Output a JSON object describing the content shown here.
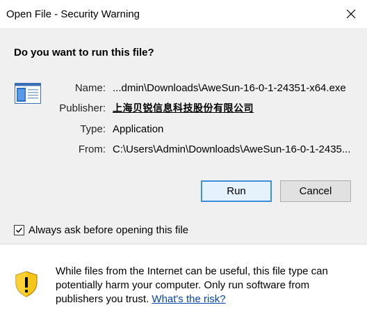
{
  "window": {
    "title": "Open File - Security Warning"
  },
  "dialog": {
    "heading": "Do you want to run this file?",
    "fields": {
      "name_label": "Name:",
      "name_value": "...dmin\\Downloads\\AweSun-16-0-1-24351-x64.exe",
      "publisher_label": "Publisher:",
      "publisher_value": "上海贝锐信息科技股份有限公司",
      "type_label": "Type:",
      "type_value": "Application",
      "from_label": "From:",
      "from_value": "C:\\Users\\Admin\\Downloads\\AweSun-16-0-1-2435..."
    },
    "buttons": {
      "run": "Run",
      "cancel": "Cancel"
    },
    "checkbox": {
      "label": "Always ask before opening this file",
      "checked": true
    }
  },
  "footer": {
    "warning_text": "While files from the Internet can be useful, this file type can potentially harm your computer. Only run software from publishers you trust.",
    "risk_link": "What's the risk?"
  },
  "icons": {
    "close": "close-icon",
    "file": "application-file-icon",
    "shield": "security-shield-icon",
    "check": "checkmark-icon"
  },
  "colors": {
    "main_background": "#f0f0f0",
    "link": "#0645ad",
    "default_button_border": "#3c8fd8",
    "default_button_fill": "#e5f1fb",
    "shield_yellow": "#f5c518"
  }
}
